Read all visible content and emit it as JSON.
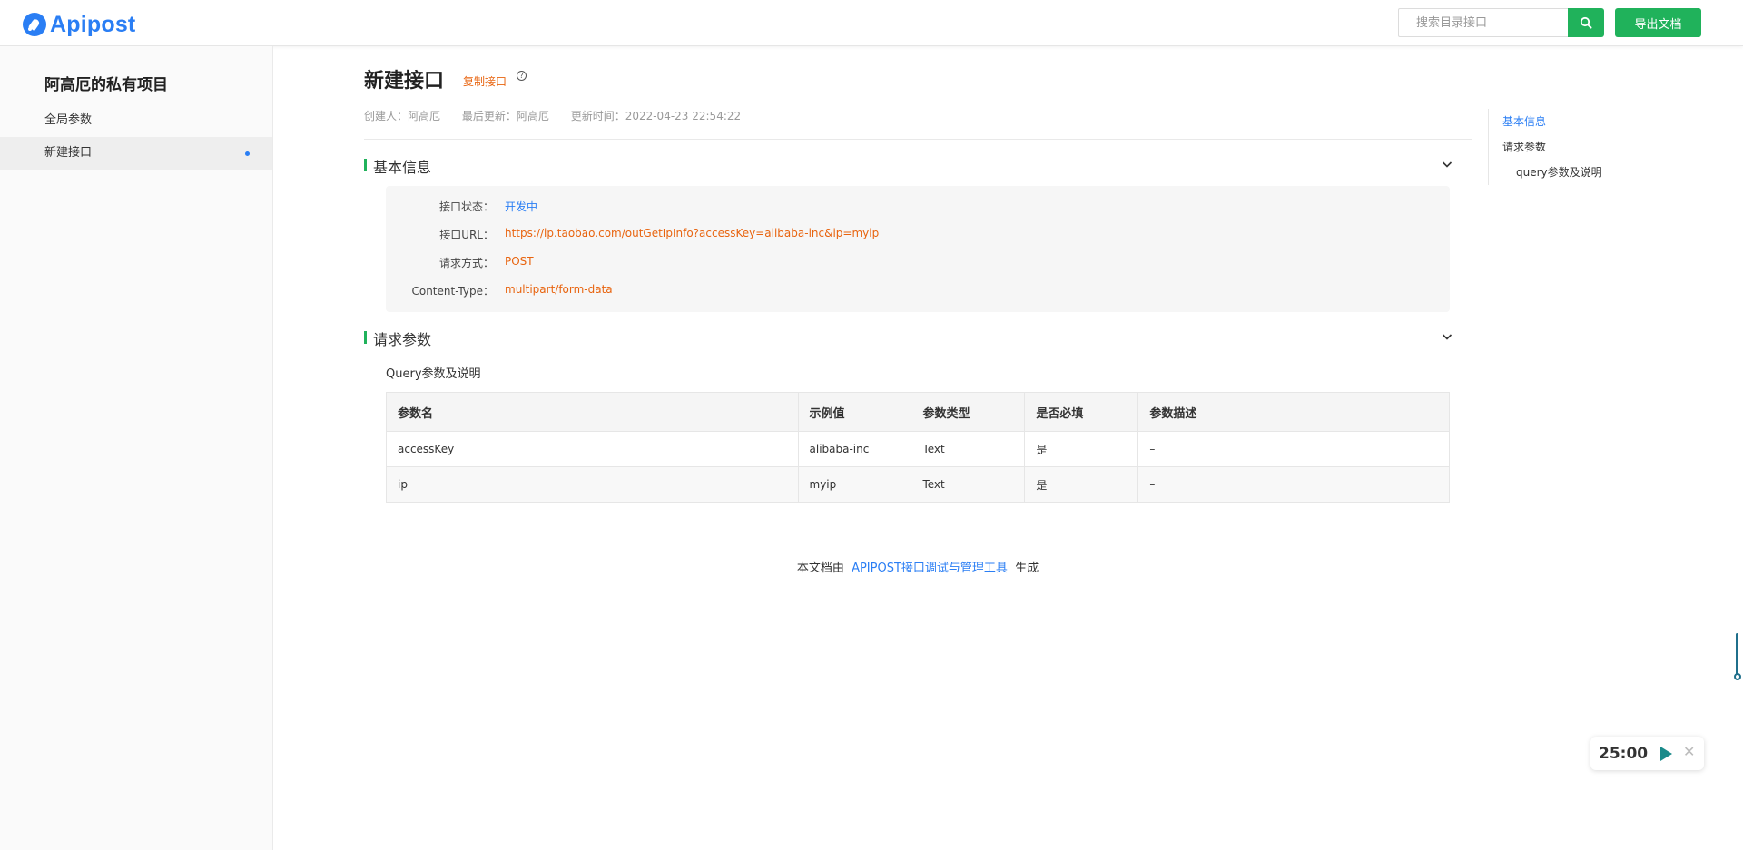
{
  "header": {
    "logo_text": "Apipost",
    "search_placeholder": "搜索目录接口",
    "export_label": "导出文档"
  },
  "sidebar": {
    "project_title": "阿高厄的私有项目",
    "items": [
      {
        "label": "全局参数",
        "active": false
      },
      {
        "label": "新建接口",
        "active": true
      }
    ]
  },
  "main": {
    "title": "新建接口",
    "copy_link": "复制接口",
    "help_glyph": "?",
    "meta": {
      "creator": "创建人：阿高厄",
      "last_update": "最后更新：阿高厄",
      "update_time": "更新时间：2022-04-23 22:54:22"
    },
    "basic_info": {
      "title": "基本信息",
      "rows": [
        {
          "label": "接口状态：",
          "value": "开发中",
          "color": "#2a7ef4"
        },
        {
          "label": "接口URL：",
          "value": "https://ip.taobao.com/outGetIpInfo?accessKey=alibaba-inc&ip=myip",
          "color": "#e8640f"
        },
        {
          "label": "请求方式：",
          "value": "POST",
          "color": "#e8640f"
        },
        {
          "label": "Content-Type：",
          "value": "multipart/form-data",
          "color": "#e8640f"
        }
      ]
    },
    "request_params": {
      "title": "请求参数",
      "query_title": "Query参数及说明",
      "columns": [
        "参数名",
        "示例值",
        "参数类型",
        "是否必填",
        "参数描述"
      ],
      "rows": [
        [
          "accessKey",
          "alibaba-inc",
          "Text",
          "是",
          "–"
        ],
        [
          "ip",
          "myip",
          "Text",
          "是",
          "–"
        ]
      ]
    },
    "footer": {
      "prefix": "本文档由",
      "link": "APIPOST接口调试与管理工具",
      "suffix": "生成"
    }
  },
  "toc": {
    "items": [
      {
        "label": "基本信息",
        "active": true
      },
      {
        "label": "请求参数",
        "active": false
      },
      {
        "label": "query参数及说明",
        "active": false
      }
    ]
  },
  "timer": {
    "time": "25:00",
    "close_glyph": "✕"
  },
  "colors": {
    "brand": "#2a7ef4",
    "primary_green": "#20b25b",
    "accent_orange": "#e8640f"
  }
}
